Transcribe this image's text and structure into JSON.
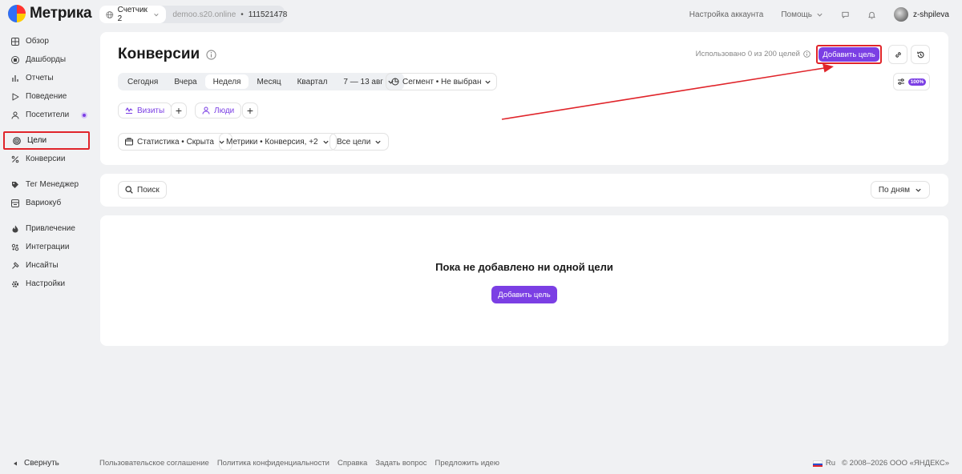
{
  "brand": {
    "name": "Метрика"
  },
  "counter": {
    "name": "Счетчик 2",
    "site": "demoo.s20.online",
    "separator": "•",
    "id": "111521478"
  },
  "topnav": {
    "account_settings": "Настройка аккаунта",
    "help": "Помощь",
    "username": "z-shpileva"
  },
  "sidebar": {
    "items": [
      {
        "label": "Обзор",
        "icon": "grid-icon"
      },
      {
        "label": "Дашборды",
        "icon": "dashboard-icon"
      },
      {
        "label": "Отчеты",
        "icon": "bar-chart-icon"
      },
      {
        "label": "Поведение",
        "icon": "play-icon"
      },
      {
        "label": "Посетители",
        "icon": "person-icon"
      },
      {
        "label": "Цели",
        "icon": "target-icon"
      },
      {
        "label": "Конверсии",
        "icon": "percent-icon"
      },
      {
        "label": "Тег Менеджер",
        "icon": "tag-icon"
      },
      {
        "label": "Вариокуб",
        "icon": "cube-icon"
      },
      {
        "label": "Привлечение",
        "icon": "flame-icon"
      },
      {
        "label": "Интеграции",
        "icon": "integrations-icon"
      },
      {
        "label": "Инсайты",
        "icon": "insights-icon"
      },
      {
        "label": "Настройки",
        "icon": "gear-icon"
      }
    ],
    "active": "Цели",
    "collapse": "Свернуть"
  },
  "header": {
    "title": "Конверсии",
    "usage": "Использовано 0 из 200 целей",
    "add_goal": "Добавить цель",
    "sampling": "100%"
  },
  "periods": {
    "items": [
      "Сегодня",
      "Вчера",
      "Неделя",
      "Месяц",
      "Квартал"
    ],
    "selected": "Неделя",
    "range": "7 — 13 авг"
  },
  "segment": "Сегмент • Не выбран",
  "chips": {
    "visits": "Визиты",
    "people": "Люди"
  },
  "filters": {
    "stat": "Статистика • Скрыта",
    "metrics": "Метрики • Конверсия, +2",
    "goals": "Все цели"
  },
  "toolbar": {
    "search": "Поиск",
    "group": "По дням"
  },
  "empty": {
    "title": "Пока не добавлено ни одной цели",
    "add_goal": "Добавить цель"
  },
  "footer": {
    "links": [
      "Пользовательское соглашение",
      "Политика конфиденциальности",
      "Справка",
      "Задать вопрос",
      "Предложить идею"
    ],
    "lang": "Ru",
    "copyright": "© 2008–2026 ООО «ЯНДЕКС»"
  },
  "colors": {
    "accent": "#7b3fe4",
    "highlight": "#e0242a"
  }
}
